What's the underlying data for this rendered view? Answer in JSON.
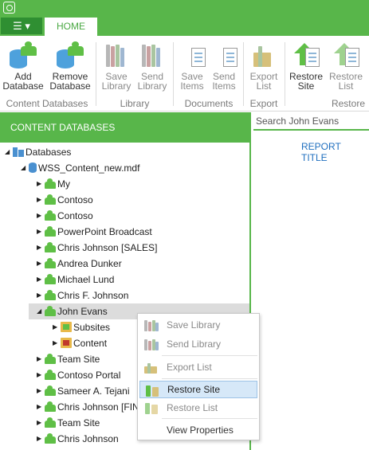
{
  "app": {
    "icon": "app-logo-icon"
  },
  "menu_button": {
    "label": "☰ ▾"
  },
  "tabs": [
    {
      "label": "HOME"
    }
  ],
  "ribbon": {
    "buttons": [
      {
        "l1": "Add",
        "l2": "Database",
        "icon": "add-database-icon"
      },
      {
        "l1": "Remove",
        "l2": "Database",
        "icon": "remove-database-icon"
      },
      {
        "l1": "Save",
        "l2": "Library",
        "icon": "save-library-icon"
      },
      {
        "l1": "Send",
        "l2": "Library",
        "icon": "send-library-icon"
      },
      {
        "l1": "Save",
        "l2": "Items",
        "icon": "save-items-icon"
      },
      {
        "l1": "Send",
        "l2": "Items",
        "icon": "send-items-icon"
      },
      {
        "l1": "Export",
        "l2": "List",
        "icon": "export-list-icon"
      },
      {
        "l1": "Restore",
        "l2": "Site",
        "icon": "restore-site-icon"
      },
      {
        "l1": "Restore",
        "l2": "List",
        "icon": "restore-list-icon"
      }
    ],
    "groups": [
      {
        "label": "Content Databases"
      },
      {
        "label": "Library"
      },
      {
        "label": "Documents"
      },
      {
        "label": "Export"
      },
      {
        "label": "Restore"
      }
    ]
  },
  "panel": {
    "title": "CONTENT DATABASES"
  },
  "tree": [
    {
      "label": "Databases",
      "icon": "databases-icon",
      "toggle": "◢"
    },
    {
      "label": "WSS_Content_new.mdf",
      "icon": "database-icon",
      "toggle": "◢"
    },
    {
      "label": "My",
      "icon": "site-icon",
      "toggle": "▶"
    },
    {
      "label": "Contoso",
      "icon": "site-icon",
      "toggle": "▶"
    },
    {
      "label": "Contoso",
      "icon": "site-icon",
      "toggle": "▶"
    },
    {
      "label": "PowerPoint Broadcast",
      "icon": "site-icon",
      "toggle": "▶"
    },
    {
      "label": "Chris Johnson [SALES]",
      "icon": "site-icon",
      "toggle": "▶"
    },
    {
      "label": "Andrea Dunker",
      "icon": "site-icon",
      "toggle": "▶"
    },
    {
      "label": "Michael Lund",
      "icon": "site-icon",
      "toggle": "▶"
    },
    {
      "label": "Chris F. Johnson",
      "icon": "site-icon",
      "toggle": "▶"
    },
    {
      "label": "John Evans",
      "icon": "site-icon",
      "toggle": "◢"
    },
    {
      "label": "Subsites",
      "icon": "subsites-folder-icon",
      "toggle": "▶"
    },
    {
      "label": "Content",
      "icon": "content-folder-icon",
      "toggle": "▶"
    },
    {
      "label": "Team Site",
      "icon": "site-icon",
      "toggle": "▶"
    },
    {
      "label": "Contoso Portal",
      "icon": "site-icon",
      "toggle": "▶"
    },
    {
      "label": "Sameer A. Tejani",
      "icon": "site-icon",
      "toggle": "▶"
    },
    {
      "label": "Chris Johnson [FIN",
      "icon": "site-icon",
      "toggle": "▶"
    },
    {
      "label": "Team Site",
      "icon": "site-icon",
      "toggle": "▶"
    },
    {
      "label": "Chris Johnson",
      "icon": "site-icon",
      "toggle": "▶"
    }
  ],
  "search": {
    "value": "Search John Evans"
  },
  "report": {
    "title": "REPORT TITLE"
  },
  "context_menu": [
    {
      "label": "Save Library",
      "icon": "save-library-icon"
    },
    {
      "label": "Send Library",
      "icon": "send-library-icon"
    },
    {
      "label": "Export List",
      "icon": "export-list-icon"
    },
    {
      "label": "Restore Site",
      "icon": "restore-site-icon"
    },
    {
      "label": "Restore List",
      "icon": "restore-list-icon"
    },
    {
      "label": "View Properties"
    }
  ],
  "colors": {
    "accent": "#58b64a",
    "accent_dark": "#2f8f32",
    "link": "#1f6fbf",
    "highlight": "#d6e8f8"
  }
}
